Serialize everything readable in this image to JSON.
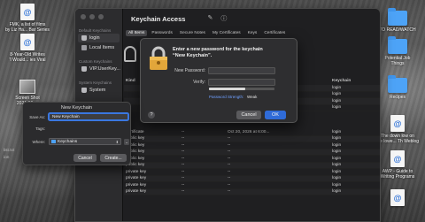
{
  "desktop": {
    "icons_left": [
      {
        "caption": "FMK, a list of films\nby Liz Ha... Bar Series"
      },
      {
        "caption": "8-Year-Old Writes\n'I Would... ies Viral"
      },
      {
        "caption": "Screen Shot\n2021-06-..."
      }
    ],
    "icons_right": [
      {
        "caption": "TO READ/WATCH"
      },
      {
        "caption": "Potential Job\nThings"
      },
      {
        "caption": "Recipes"
      },
      {
        "caption": "The down low on\nthe lowe... Th Weblog"
      },
      {
        "caption": "AWP - Guide to\nWriting Programs"
      }
    ]
  },
  "keychain": {
    "title": "Keychain Access",
    "sidebar": {
      "default_heading": "Default Keychains",
      "default_items": [
        {
          "label": "login",
          "selected": true
        },
        {
          "label": "Local Items",
          "selected": false
        }
      ],
      "custom_heading": "Custom Keychains",
      "custom_items": [
        {
          "label": "VIP.UserKey..."
        }
      ],
      "system_heading": "System Keychains",
      "system_items": [
        {
          "label": "System"
        }
      ]
    },
    "tabs": [
      {
        "label": "All Items",
        "selected": true
      },
      {
        "label": "Passwords",
        "selected": false
      },
      {
        "label": "Secure Notes",
        "selected": false
      },
      {
        "label": "My Certificates",
        "selected": false
      },
      {
        "label": "Keys",
        "selected": false
      },
      {
        "label": "Certificates",
        "selected": false
      }
    ],
    "table": {
      "columns": {
        "kind": "Kind",
        "expires": "Expires",
        "keychain": "Keychain"
      },
      "rows": [
        {
          "kind": "",
          "modified": "",
          "expires": "",
          "keychain": "login"
        },
        {
          "kind": "",
          "modified": "",
          "expires": "",
          "keychain": "login"
        },
        {
          "kind": "",
          "modified": "",
          "expires": "",
          "keychain": "login"
        },
        {
          "kind": "",
          "modified": "",
          "expires": "",
          "keychain": "login"
        },
        {
          "kind": "certificate",
          "modified": "--",
          "expires": "Oct 20, 2026 at 6:00...",
          "keychain": "login"
        },
        {
          "kind": "public key",
          "modified": "--",
          "expires": "--",
          "keychain": "login"
        },
        {
          "kind": "public key",
          "modified": "--",
          "expires": "--",
          "keychain": "login"
        },
        {
          "kind": "public key",
          "modified": "--",
          "expires": "--",
          "keychain": "login"
        },
        {
          "kind": "public key",
          "modified": "--",
          "expires": "--",
          "keychain": "login"
        },
        {
          "kind": "public key",
          "modified": "--",
          "expires": "--",
          "keychain": "login"
        },
        {
          "kind": "private key",
          "modified": "--",
          "expires": "--",
          "keychain": "login"
        },
        {
          "kind": "private key",
          "modified": "--",
          "expires": "--",
          "keychain": "login"
        },
        {
          "kind": "private key",
          "modified": "--",
          "expires": "--",
          "keychain": "login"
        },
        {
          "kind": "private key",
          "modified": "--",
          "expires": "--",
          "keychain": "login"
        }
      ]
    }
  },
  "password_sheet": {
    "title_line1": "Enter a new password for the keychain",
    "title_line2": "“New Keychain”.",
    "new_password_label": "New Password:",
    "verify_label": "Verify:",
    "strength_label": "Password Strength:",
    "strength_value": "Weak",
    "strength_fraction": 0.55,
    "help_label": "?",
    "cancel_label": "Cancel",
    "ok_label": "OK"
  },
  "new_keychain_dialog": {
    "title": "New Keychain",
    "save_as_label": "Save As:",
    "save_as_value": "New Keychain",
    "tags_label": "Tags:",
    "where_label": "Where:",
    "where_value": "Keychains",
    "cancel_label": "Cancel",
    "create_label": "Create..."
  },
  "behind_window_rows": [
    "list.txt",
    "ion"
  ]
}
